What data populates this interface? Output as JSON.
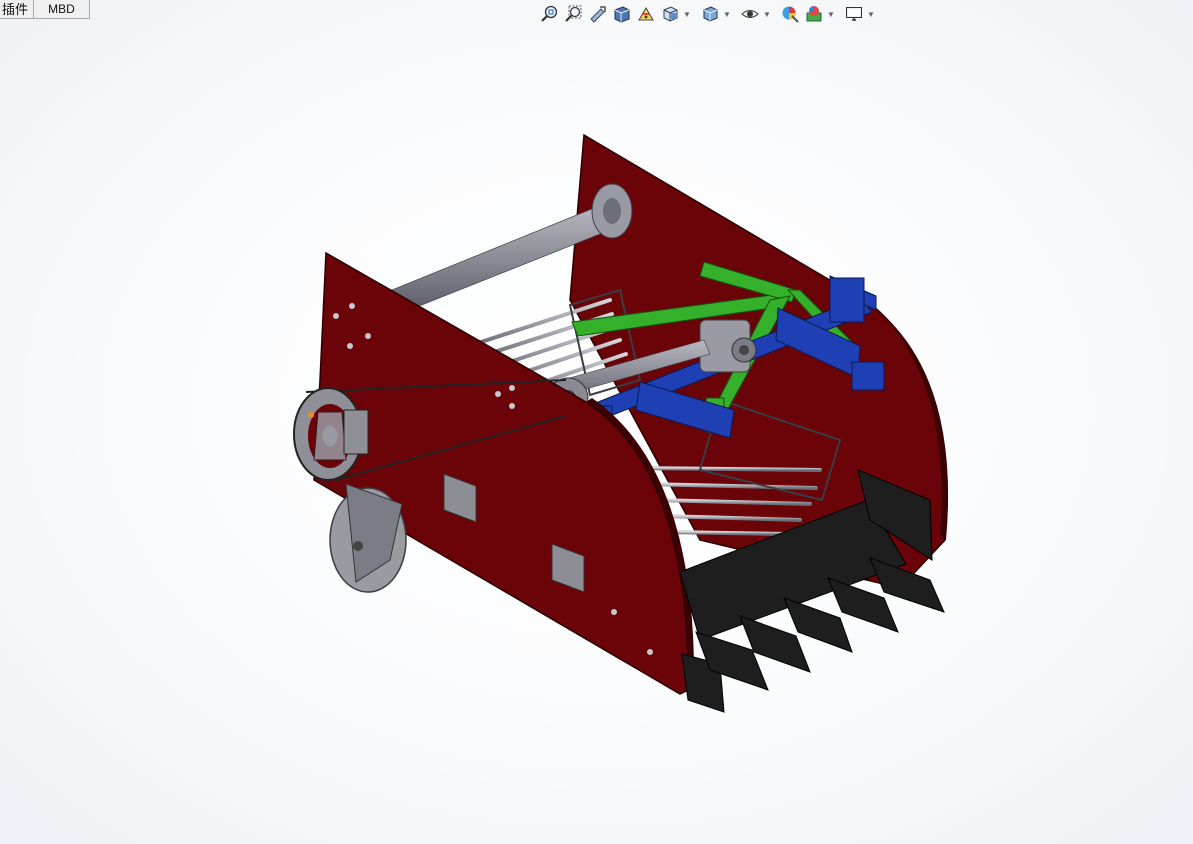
{
  "command_tabs": [
    {
      "label": "插件"
    },
    {
      "label": "MBD"
    }
  ],
  "heads_up_toolbar": {
    "buttons": [
      {
        "icon": "zoom-to-fit-icon"
      },
      {
        "icon": "zoom-to-area-icon"
      },
      {
        "icon": "previous-view-icon"
      },
      {
        "icon": "section-view-icon"
      },
      {
        "icon": "dynamic-annotation-icon"
      },
      {
        "icon": "view-orientation-icon",
        "dropdown": true
      },
      {
        "icon": "display-style-icon",
        "dropdown": true
      },
      {
        "icon": "hide-show-items-icon",
        "dropdown": true
      },
      {
        "icon": "edit-appearance-icon"
      },
      {
        "icon": "apply-scene-icon",
        "dropdown": true
      },
      {
        "icon": "view-settings-icon",
        "dropdown": true
      }
    ]
  },
  "model": {
    "colors": {
      "frame_panel": "#6b0408",
      "edge": "#2a0000",
      "shaft": "#8e8e98",
      "hitch_frame": "#1f3fb4",
      "linkage": "#35b02a",
      "digger_blade": "#1e1e1e",
      "gauge_wheel": "#9a9aa2",
      "background_center": "#ffffff",
      "background_edge": "#eef1f5"
    }
  }
}
